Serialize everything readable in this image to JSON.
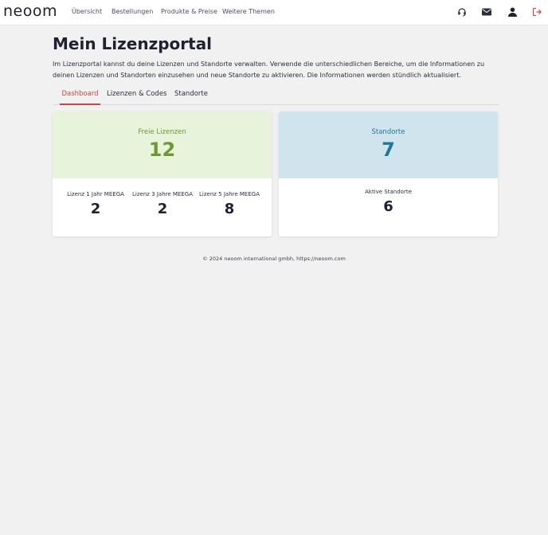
{
  "brand": {
    "logo_text": "neoom"
  },
  "nav": {
    "links": [
      "Übersicht",
      "Bestellungen",
      "Produkte & Preise",
      "Weitere Themen"
    ],
    "icons": [
      "headset-icon",
      "mail-icon",
      "user-icon",
      "logout-icon"
    ],
    "logout_color": "#d64541"
  },
  "page": {
    "title": "Mein Lizenzportal",
    "intro": "Im Lizenzportal kannst du deine Lizenzen und Standorte verwalten. Verwende die unterschiedlichen Bereiche, um die Informationen zu deinen Lizenzen und Standorten einzusehen und neue Standorte zu aktivieren. Die Informationen werden stündlich aktualisiert."
  },
  "tabs": [
    {
      "label": "Dashboard",
      "active": true
    },
    {
      "label": "Lizenzen & Codes",
      "active": false
    },
    {
      "label": "Standorte",
      "active": false
    }
  ],
  "licenses_card": {
    "label": "Freie Lizenzen",
    "value": "12",
    "bg": "#e8f3dc",
    "accent": "#6a9b2f",
    "breakdown": [
      {
        "label": "Lizenz 1 Jahr MEEGA",
        "value": "2"
      },
      {
        "label": "Lizenz 3 Jahre MEEGA",
        "value": "2"
      },
      {
        "label": "Lizenz 5 Jahre MEEGA",
        "value": "8"
      }
    ]
  },
  "locations_card": {
    "label": "Standorte",
    "value": "7",
    "bg": "#cfe4ec",
    "accent": "#1d7a94",
    "active_label": "Aktive Standorte",
    "active_value": "6"
  },
  "footer": {
    "text": "© 2024 neoom international gmbh, https://neoom.com"
  }
}
